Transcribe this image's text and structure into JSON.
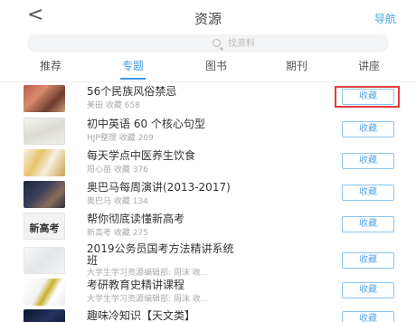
{
  "header": {
    "back_label": "<",
    "title": "资源",
    "nav_label": "导航"
  },
  "search": {
    "placeholder": "找资料"
  },
  "tabs": [
    "推荐",
    "专题",
    "图书",
    "期刊",
    "讲座"
  ],
  "active_tab": "专题",
  "items": [
    {
      "title": "56个民族风俗禁忌",
      "meta": "美田   收藏 658",
      "button": "收藏",
      "thumb": "photo-ethnic"
    },
    {
      "title": "初中英语 60 个核心句型",
      "meta": "HJP整理   收藏 209",
      "button": "收藏",
      "thumb": "photo-notebook"
    },
    {
      "title": "每天学点中医养生饮食",
      "meta": "周心苗   收藏 376",
      "button": "收藏",
      "thumb": "photo-herbs"
    },
    {
      "title": "奥巴马每周演讲(2013-2017)",
      "meta": "奥巴马   收藏 134",
      "button": "收藏",
      "thumb": "photo-obama"
    },
    {
      "title": "帮你彻底读懂新高考",
      "meta": "新高考   收藏 275",
      "button": "收藏",
      "thumb_text": "新高考"
    },
    {
      "title": "2019公务员国考方法精讲系统",
      "title_line2": "班",
      "meta": "大学生学习资源编辑部: 周沫   收...",
      "button": "收藏",
      "thumb": "photo-exam"
    },
    {
      "title": "考研教育史精讲课程",
      "meta": "大学生学习资源编辑部: 周沫   收...",
      "button": "收藏",
      "thumb": "photo-history"
    },
    {
      "title": "趣味冷知识【天文类】",
      "meta": "",
      "button": "收藏",
      "thumb": "photo-astronomy"
    }
  ]
}
